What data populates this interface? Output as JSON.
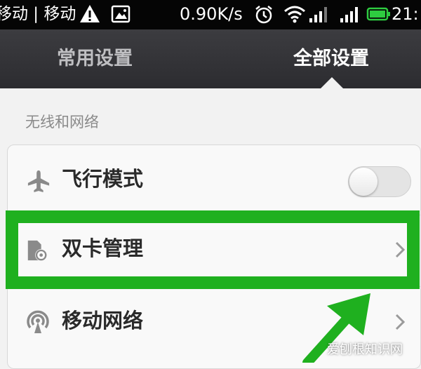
{
  "status_bar": {
    "carrier": "移动 | 移动",
    "speed": "0.90K/s",
    "time": "21:",
    "icons": [
      "warning-icon",
      "image-notification-icon",
      "alarm-icon",
      "wifi-icon",
      "signal-icon",
      "signal-icon",
      "battery-icon"
    ],
    "battery_color": "#2ecc40"
  },
  "tabs": {
    "common": "常用设置",
    "all": "全部设置",
    "selected": "all"
  },
  "section": {
    "header": "无线和网络"
  },
  "rows": {
    "airplane": {
      "label": "飞行模式",
      "icon": "airplane-icon",
      "toggle_on": false
    },
    "dual_sim": {
      "label": "双卡管理",
      "icon": "sim-card-icon"
    },
    "mobile_network": {
      "label": "移动网络",
      "icon": "antenna-icon"
    }
  },
  "annotation": {
    "highlight_color": "#1fb01f",
    "arrow_color": "#1fb01f"
  },
  "watermark": "爱刨根知识网"
}
